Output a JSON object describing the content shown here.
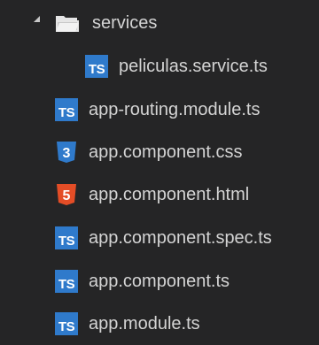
{
  "tree": {
    "folder": {
      "label": "services",
      "icon": "folder-open-icon",
      "expanded": true
    },
    "files": [
      {
        "label": "peliculas.service.ts",
        "icon": "typescript-file-icon",
        "icon_text": "TS",
        "nested": true
      },
      {
        "label": "app-routing.module.ts",
        "icon": "typescript-file-icon",
        "icon_text": "TS",
        "nested": false
      },
      {
        "label": "app.component.css",
        "icon": "css-file-icon",
        "icon_text": "3",
        "nested": false
      },
      {
        "label": "app.component.html",
        "icon": "html-file-icon",
        "icon_text": "5",
        "nested": false
      },
      {
        "label": "app.component.spec.ts",
        "icon": "typescript-file-icon",
        "icon_text": "TS",
        "nested": false
      },
      {
        "label": "app.component.ts",
        "icon": "typescript-file-icon",
        "icon_text": "TS",
        "nested": false
      },
      {
        "label": "app.module.ts",
        "icon": "typescript-file-icon",
        "icon_text": "TS",
        "nested": false
      }
    ]
  },
  "colors": {
    "background": "#252526",
    "text": "#d4d4d4",
    "typescript": "#2f7acb",
    "css": "#2f7acb",
    "html": "#e44d26",
    "folder": "#e6e6e6"
  }
}
